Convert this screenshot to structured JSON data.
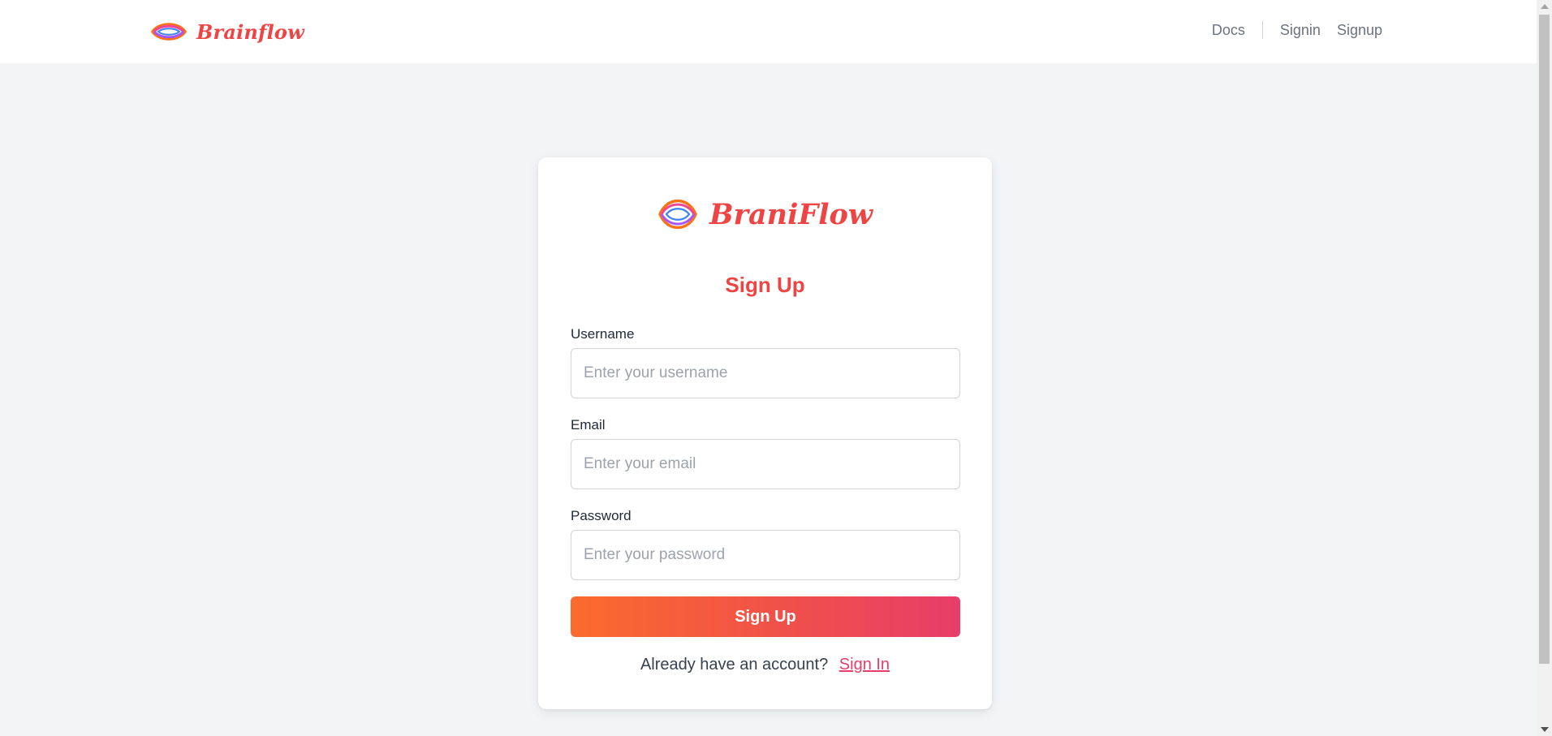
{
  "header": {
    "brand_name": "Brainflow",
    "nav": {
      "docs": "Docs",
      "signin": "Signin",
      "signup": "Signup"
    }
  },
  "card": {
    "brand_name": "BraniFlow",
    "title": "Sign Up",
    "fields": {
      "username": {
        "label": "Username",
        "placeholder": "Enter your username"
      },
      "email": {
        "label": "Email",
        "placeholder": "Enter your email"
      },
      "password": {
        "label": "Password",
        "placeholder": "Enter your password"
      }
    },
    "submit_label": "Sign Up",
    "footer_text": "Already have an account?",
    "footer_link": "Sign In"
  },
  "icons": {
    "logo": "brainflow-logo-icon"
  },
  "colors": {
    "brand": "#ef4444",
    "gradient_start": "#fb6b2d",
    "gradient_end": "#e73d6a",
    "page_bg": "#f3f4f6"
  }
}
